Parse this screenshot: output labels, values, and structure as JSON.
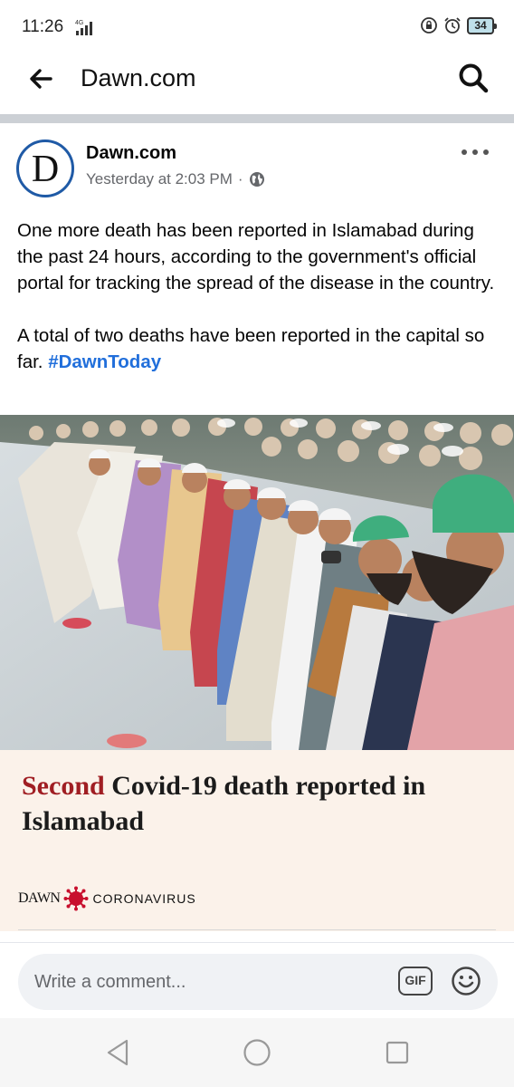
{
  "status_bar": {
    "time": "11:26",
    "network": "4G",
    "battery": "34"
  },
  "header": {
    "title": "Dawn.com"
  },
  "post": {
    "page_name": "Dawn.com",
    "avatar_letter": "D",
    "timestamp": "Yesterday at 2:03 PM",
    "separator": "·",
    "audience_icon": "globe-icon",
    "paragraph_1": "One more death has been reported in Islamabad during the past 24 hours, according to the government's official portal for tracking the spread of the disease in the country.",
    "paragraph_2": "A total of two deaths have been reported in the capital so far.",
    "hashtag": "#DawnToday"
  },
  "link_card": {
    "headline_highlight": "Second",
    "headline_rest": " Covid-19 death reported in Islamabad",
    "brand_name": "DAWN",
    "brand_section": "CORONAVIRUS"
  },
  "comment_bar": {
    "placeholder": "Write a comment...",
    "gif_label": "GIF"
  },
  "colors": {
    "hashtag": "#216fdb",
    "headline_highlight": "#a01e23",
    "card_background": "#fbf2ea",
    "avatar_border": "#1f5aa6",
    "virus": "#c8102e"
  }
}
